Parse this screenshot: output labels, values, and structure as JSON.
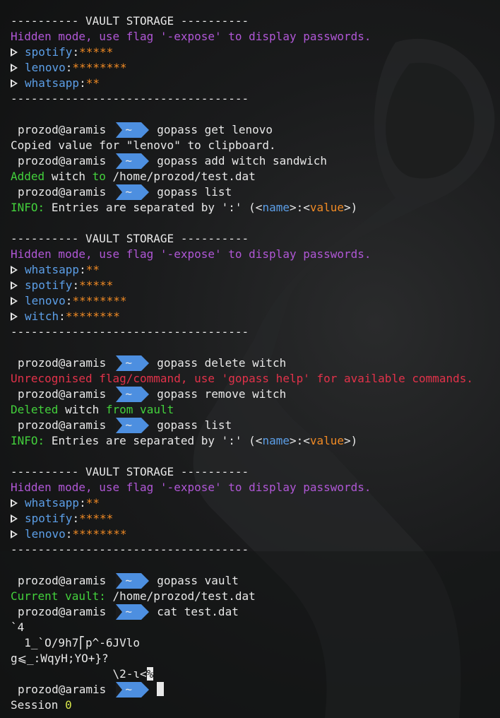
{
  "vault_header": "---------- VAULT STORAGE ----------",
  "hidden_mode": "Hidden mode, use flag '-expose' to display passwords.",
  "separator": "-----------------------------------",
  "prompt_user": "prozod@aramis",
  "prompt_dir": "~",
  "block1": {
    "entries": [
      {
        "name": "spotify",
        "value": "*****"
      },
      {
        "name": "lenovo",
        "value": "********"
      },
      {
        "name": "whatsapp",
        "value": "**"
      }
    ]
  },
  "cmd1": "gopass get lenovo",
  "out1": "Copied value for \"lenovo\" to clipboard.",
  "cmd2": "gopass add witch sandwich",
  "out2": {
    "added": "Added",
    "name": "witch",
    "to": "to",
    "path": "/home/prozod/test.dat"
  },
  "cmd3": "gopass list",
  "info": {
    "label": "INFO:",
    "text": "Entries are separated by ':' (<",
    "name": "name",
    "mid": ">:<",
    "value": "value",
    "end": ">)"
  },
  "block2": {
    "entries": [
      {
        "name": "whatsapp",
        "value": "**"
      },
      {
        "name": "spotify",
        "value": "*****"
      },
      {
        "name": "lenovo",
        "value": "********"
      },
      {
        "name": "witch",
        "value": "********"
      }
    ]
  },
  "cmd4": "gopass delete witch",
  "error": "Unrecognised flag/command, use 'gopass help' for available commands.",
  "cmd5": "gopass remove witch",
  "out5": {
    "deleted": "Deleted",
    "name": "witch",
    "from": "from vault"
  },
  "cmd6": "gopass list",
  "block3": {
    "entries": [
      {
        "name": "whatsapp",
        "value": "**"
      },
      {
        "name": "spotify",
        "value": "*****"
      },
      {
        "name": "lenovo",
        "value": "********"
      }
    ]
  },
  "cmd7": "gopass vault",
  "vault_out": {
    "label": "Current vault:",
    "path": "/home/prozod/test.dat"
  },
  "cmd8": "cat test.dat",
  "garbage": [
    "`4",
    "  1̲`O/9h7⎡p^-6JVlo",
    "g⩽_:WqyH;YO+}?",
    "               \\2-ɩ<"
  ],
  "garbage_end": "%",
  "session": {
    "label": "Session",
    "num": "0"
  },
  "colors": {
    "purple": "#b057d6",
    "blue": "#5c9fe8",
    "orange": "#f08a24",
    "green": "#43d13c",
    "red": "#e2324a",
    "badge": "#4d8fe0"
  }
}
